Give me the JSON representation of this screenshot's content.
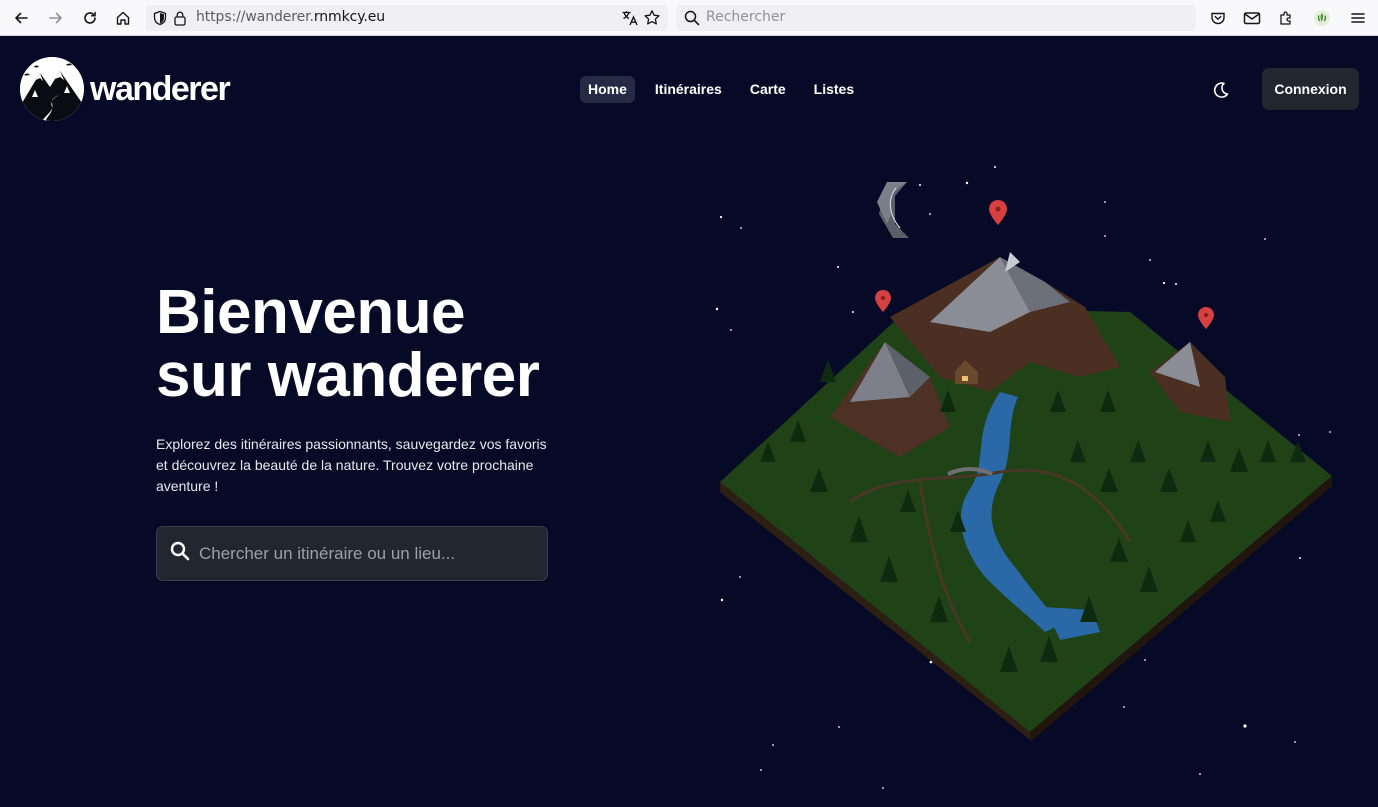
{
  "browser": {
    "url_prefix": "https://wanderer.",
    "url_domain": "rnmkcy.eu",
    "search_placeholder": "Rechercher"
  },
  "site": {
    "logo_text": "wanderer",
    "nav": [
      {
        "label": "Home",
        "active": true
      },
      {
        "label": "Itinéraires",
        "active": false
      },
      {
        "label": "Carte",
        "active": false
      },
      {
        "label": "Listes",
        "active": false
      }
    ],
    "login_label": "Connexion"
  },
  "hero": {
    "title_line1": "Bienvenue",
    "title_line2": "sur wanderer",
    "text": "Explorez des itinéraires passionnants, sauvegardez vos favoris et découvrez la beauté de la nature. Trouvez votre prochaine aventure !",
    "search_placeholder": "Chercher un itinéraire ou un lieu..."
  },
  "colors": {
    "page_background": "#070a26",
    "button_background": "#22262f",
    "active_nav": "#262b45",
    "pin_red": "#d64040"
  },
  "icons": [
    "back-arrow-icon",
    "forward-arrow-icon",
    "reload-icon",
    "home-icon",
    "shield-icon",
    "lock-icon",
    "translate-icon",
    "bookmark-star-icon",
    "search-icon",
    "pocket-icon",
    "mail-icon",
    "extensions-icon",
    "account-icon",
    "menu-icon",
    "moon-icon"
  ]
}
